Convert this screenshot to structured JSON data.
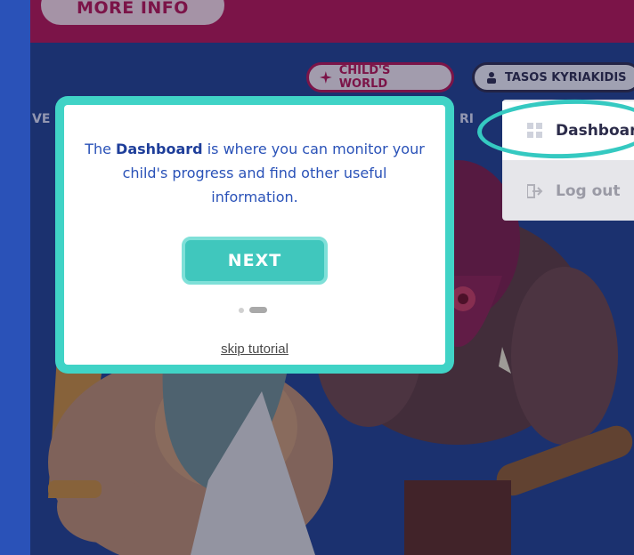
{
  "header": {
    "more_info_label": "MORE INFO"
  },
  "nav": {
    "childs_world_label": "CHILD'S WORLD",
    "user_name": "TASOS KYRIAKIDIS",
    "side_text_left": "VE",
    "side_text_right": "RI"
  },
  "user_menu": {
    "items": [
      {
        "label": "Dashboard",
        "icon": "grid-icon"
      },
      {
        "label": "Log out",
        "icon": "logout-icon"
      }
    ]
  },
  "tutorial": {
    "text_before": "The ",
    "text_bold": "Dashboard",
    "text_after": " is where you can monitor your child's progress and find other useful information.",
    "next_label": "NEXT",
    "skip_label": "skip tutorial",
    "steps_total": 2,
    "current_step": 2
  },
  "colors": {
    "accent_teal": "#40d3c6",
    "brand_magenta": "#b3134f",
    "background_blue": "#2a52b8"
  }
}
